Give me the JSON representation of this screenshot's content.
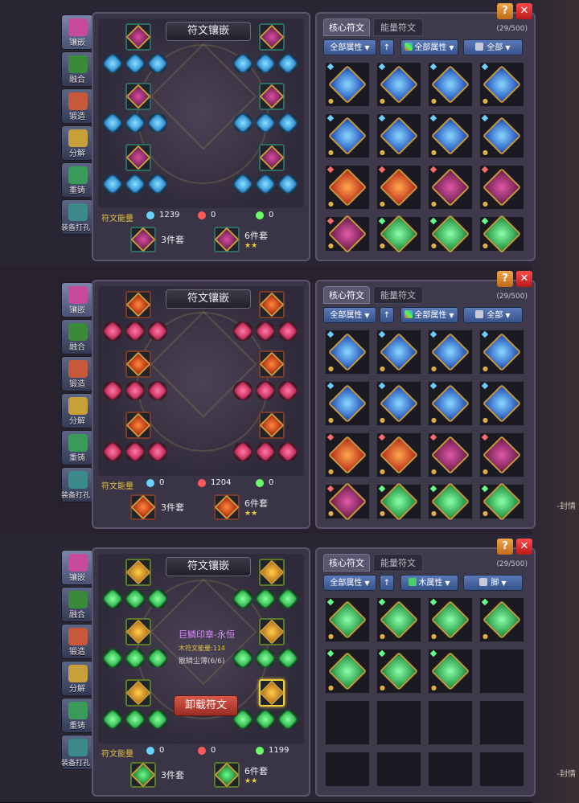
{
  "sidebar": [
    {
      "label": "镶嵌",
      "icon": "inlay-icon",
      "active": true
    },
    {
      "label": "融合",
      "icon": "fusion-icon"
    },
    {
      "label": "锻造",
      "icon": "forge-icon"
    },
    {
      "label": "分解",
      "icon": "decompose-icon"
    },
    {
      "label": "重铸",
      "icon": "recast-icon"
    },
    {
      "label": "装备打孔",
      "icon": "punch-icon"
    }
  ],
  "panel_title": "符文镶嵌",
  "tabs": {
    "core": "核心符文",
    "energy": "能量符文"
  },
  "energy_label": "符文能量",
  "set3": "3件套",
  "set6": "6件套",
  "stars": "★★",
  "help": "?",
  "close": "✕",
  "screens": [
    {
      "energy": [
        "1239",
        "0",
        "0"
      ],
      "count": "(29/500)",
      "filters": [
        "全部属性",
        "↑",
        "全部属性",
        "全部"
      ],
      "filter3_icon": "rainbow-icon",
      "filter4_icon": "robot-icon"
    },
    {
      "energy": [
        "0",
        "1204",
        "0"
      ],
      "count": "(29/500)",
      "filters": [
        "全部属性",
        "↑",
        "全部属性",
        "全部"
      ],
      "filter3_icon": "rainbow-icon",
      "filter4_icon": "robot-icon"
    },
    {
      "energy": [
        "0",
        "0",
        "1199"
      ],
      "count": "(29/500)",
      "filters": [
        "全部属性",
        "↑",
        "木属性",
        "脚"
      ],
      "filter3_icon": "wood-icon",
      "filter4_icon": "boot-icon",
      "tooltip": {
        "name": "巨鳞印章-永恒",
        "energy": "木符文能量:114",
        "set": "散鳞尘薄(6/6)"
      },
      "unload": "卸载符文"
    }
  ],
  "side_text": "-封情"
}
